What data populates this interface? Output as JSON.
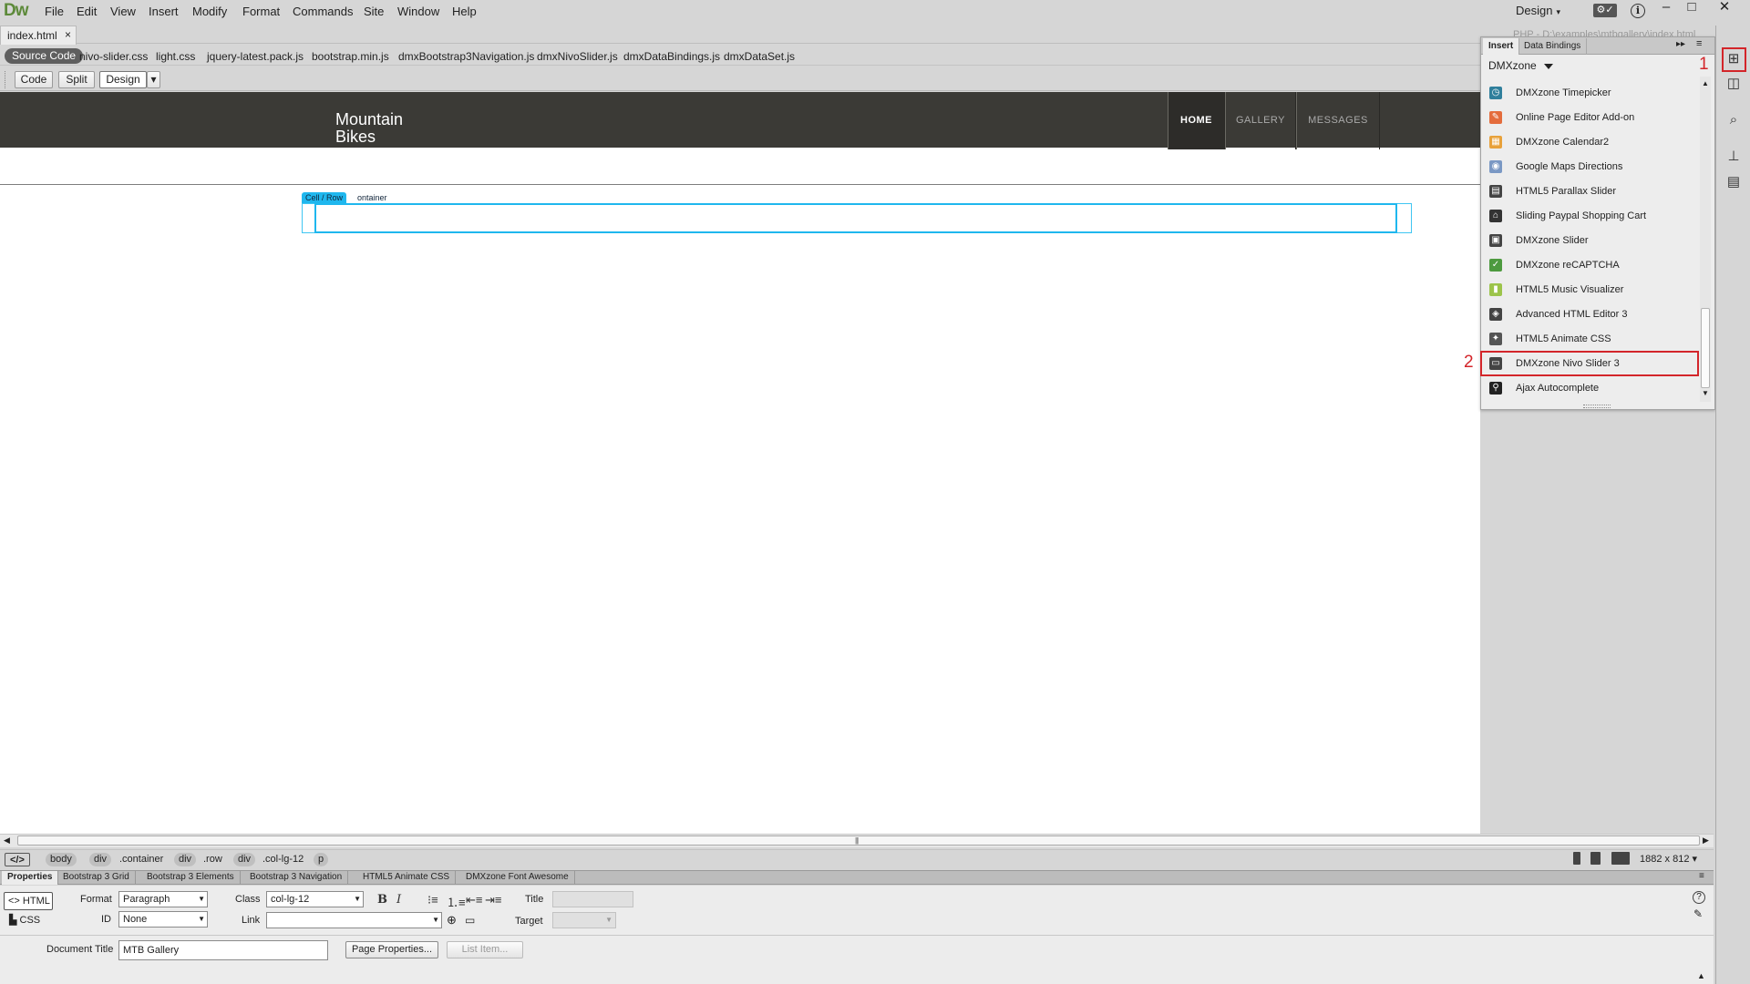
{
  "app": {
    "logo": "Dw",
    "menu": [
      "File",
      "Edit",
      "View",
      "Insert",
      "Modify",
      "Format",
      "Commands",
      "Site",
      "Window",
      "Help"
    ],
    "workspace": "Design",
    "window_buttons": [
      "–",
      "□",
      "✕"
    ]
  },
  "document": {
    "tab_name": "index.html",
    "close_glyph": "×",
    "path": "PHP - D:\\examples\\mtbgallery\\index.html"
  },
  "related_files": {
    "source_code": "Source Code",
    "files": [
      "nivo-slider.css",
      "light.css",
      "jquery-latest.pack.js",
      "bootstrap.min.js",
      "dmxBootstrap3Navigation.js",
      "dmxNivoSlider.js",
      "dmxDataBindings.js",
      "dmxDataSet.js"
    ]
  },
  "view_toolbar": {
    "code": "Code",
    "split": "Split",
    "design": "Design",
    "dropdown": "▾"
  },
  "canvas": {
    "brand": "Mountain Bikes",
    "nav": [
      "HOME",
      "GALLERY",
      "MESSAGES"
    ],
    "element_tag": "Cell  / Row",
    "element_tag_2": "ontainer"
  },
  "insert_panel": {
    "tabs": [
      "Insert",
      "Data Bindings"
    ],
    "collapse_glyph": "▸▸",
    "menu_glyph": "≡",
    "category": "DMXzone",
    "items": [
      {
        "label": "DMXzone Timepicker",
        "icon": "timepicker-icon",
        "color": "#2f7f9c",
        "glyph": "◷"
      },
      {
        "label": "Online Page Editor Add-on",
        "icon": "page-editor-icon",
        "color": "#e46c3c",
        "glyph": "✎"
      },
      {
        "label": "DMXzone Calendar2",
        "icon": "calendar-icon",
        "color": "#e8a13a",
        "glyph": "▦"
      },
      {
        "label": "Google Maps Directions",
        "icon": "maps-icon",
        "color": "#7a98c4",
        "glyph": "◉"
      },
      {
        "label": "HTML5 Parallax Slider",
        "icon": "parallax-icon",
        "color": "#444444",
        "glyph": "▤"
      },
      {
        "label": "Sliding Paypal Shopping Cart",
        "icon": "cart-icon",
        "color": "#333333",
        "glyph": "⌂"
      },
      {
        "label": "DMXzone Slider",
        "icon": "slider-icon",
        "color": "#444444",
        "glyph": "▣"
      },
      {
        "label": "DMXzone reCAPTCHA",
        "icon": "recaptcha-icon",
        "color": "#4d9a3f",
        "glyph": "✓"
      },
      {
        "label": "HTML5 Music Visualizer",
        "icon": "music-icon",
        "color": "#9cc44a",
        "glyph": "▮"
      },
      {
        "label": "Advanced HTML Editor 3",
        "icon": "html-editor-icon",
        "color": "#444444",
        "glyph": "◈"
      },
      {
        "label": "HTML5 Animate CSS",
        "icon": "animate-icon",
        "color": "#555555",
        "glyph": "✦"
      },
      {
        "label": "DMXzone Nivo Slider 3",
        "icon": "nivo-slider-icon",
        "color": "#444444",
        "glyph": "▭"
      },
      {
        "label": "Ajax Autocomplete",
        "icon": "search-icon",
        "color": "#222222",
        "glyph": "⚲"
      }
    ],
    "scroll_up": "▲",
    "scroll_down": "▼"
  },
  "annotations": {
    "one": "1",
    "two": "2"
  },
  "dock": {
    "icons": [
      "insert-panel-icon",
      "database-icon",
      "code-inspector-icon",
      "sitemap-icon",
      "assets-icon"
    ]
  },
  "tag_selector": {
    "code_glyph": "</>",
    "tags": [
      "body",
      "div",
      ".container",
      "div",
      ".row",
      "div",
      ".col-lg-12",
      "p"
    ],
    "window_size": "1882 x 812 ▾"
  },
  "properties": {
    "tabs": [
      "Properties",
      "Bootstrap 3 Grid",
      "Bootstrap 3 Elements",
      "Bootstrap 3 Navigation",
      "HTML5 Animate CSS",
      "DMXzone Font Awesome"
    ],
    "html_label": "<> HTML",
    "css_label": "CSS",
    "format_label": "Format",
    "format_value": "Paragraph",
    "id_label": "ID",
    "id_value": "None",
    "class_label": "Class",
    "class_value": "col-lg-12",
    "link_label": "Link",
    "link_value": "",
    "bold": "B",
    "italic": "I",
    "title_label": "Title",
    "target_label": "Target",
    "doc_title_label": "Document Title",
    "doc_title_value": "MTB Gallery",
    "page_properties": "Page Properties...",
    "list_item": "List Item...",
    "help_glyph": "?",
    "menu_glyph": "≡"
  },
  "colors": {
    "accent_red": "#d3252a",
    "selection_blue": "#1fb7ee",
    "site_nav_bg": "#3b3a36",
    "logo_green": "#5d8a3a"
  }
}
